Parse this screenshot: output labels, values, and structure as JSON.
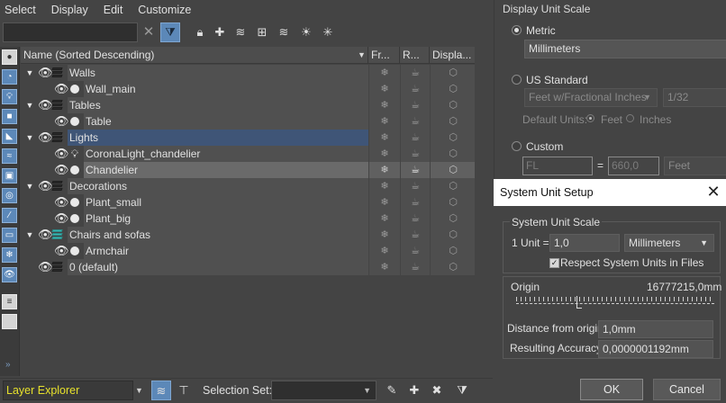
{
  "menu": {
    "items": [
      "Select",
      "Display",
      "Edit",
      "Customize"
    ]
  },
  "explorer": {
    "columns": {
      "name": "Name (Sorted Descending)",
      "frozen": "Fr...",
      "render": "R...",
      "display": "Displa..."
    },
    "rows": [
      {
        "name": "Walls"
      },
      {
        "name": "Wall_main"
      },
      {
        "name": "Tables"
      },
      {
        "name": "Table"
      },
      {
        "name": "Lights"
      },
      {
        "name": "CoronaLight_chandelier"
      },
      {
        "name": "Chandelier"
      },
      {
        "name": "Decorations"
      },
      {
        "name": "Plant_small"
      },
      {
        "name": "Plant_big"
      },
      {
        "name": "Chairs and sofas"
      },
      {
        "name": "Armchair"
      },
      {
        "name": "0 (default)"
      }
    ],
    "footer": {
      "explorer_name": "Layer Explorer",
      "selection_set_label": "Selection Set:",
      "selection_set_value": ""
    }
  },
  "units": {
    "display_scale_title": "Display Unit Scale",
    "metric_label": "Metric",
    "metric_value": "Millimeters",
    "us_label": "US Standard",
    "us_value": "Feet w/Fractional Inches",
    "us_fraction": "1/32",
    "default_units_label": "Default Units:",
    "feet_label": "Feet",
    "inches_label": "Inches",
    "custom_label": "Custom",
    "custom_name": "FL",
    "custom_equals": "=",
    "custom_value": "660,0",
    "custom_unit": "Feet"
  },
  "system_unit_setup": {
    "title": "System Unit Setup",
    "group_label": "System Unit Scale",
    "unit_label": "1 Unit =",
    "unit_value": "1,0",
    "unit_type": "Millimeters",
    "respect_label": "Respect System Units in Files",
    "respect_checked": true,
    "origin_label": "Origin",
    "origin_value": "16777215,0mm",
    "distance_label": "Distance from origin:",
    "distance_value": "1,0mm",
    "accuracy_label": "Resulting Accuracy:",
    "accuracy_value": "0,0000001192mm",
    "ok_label": "OK",
    "cancel_label": "Cancel"
  }
}
